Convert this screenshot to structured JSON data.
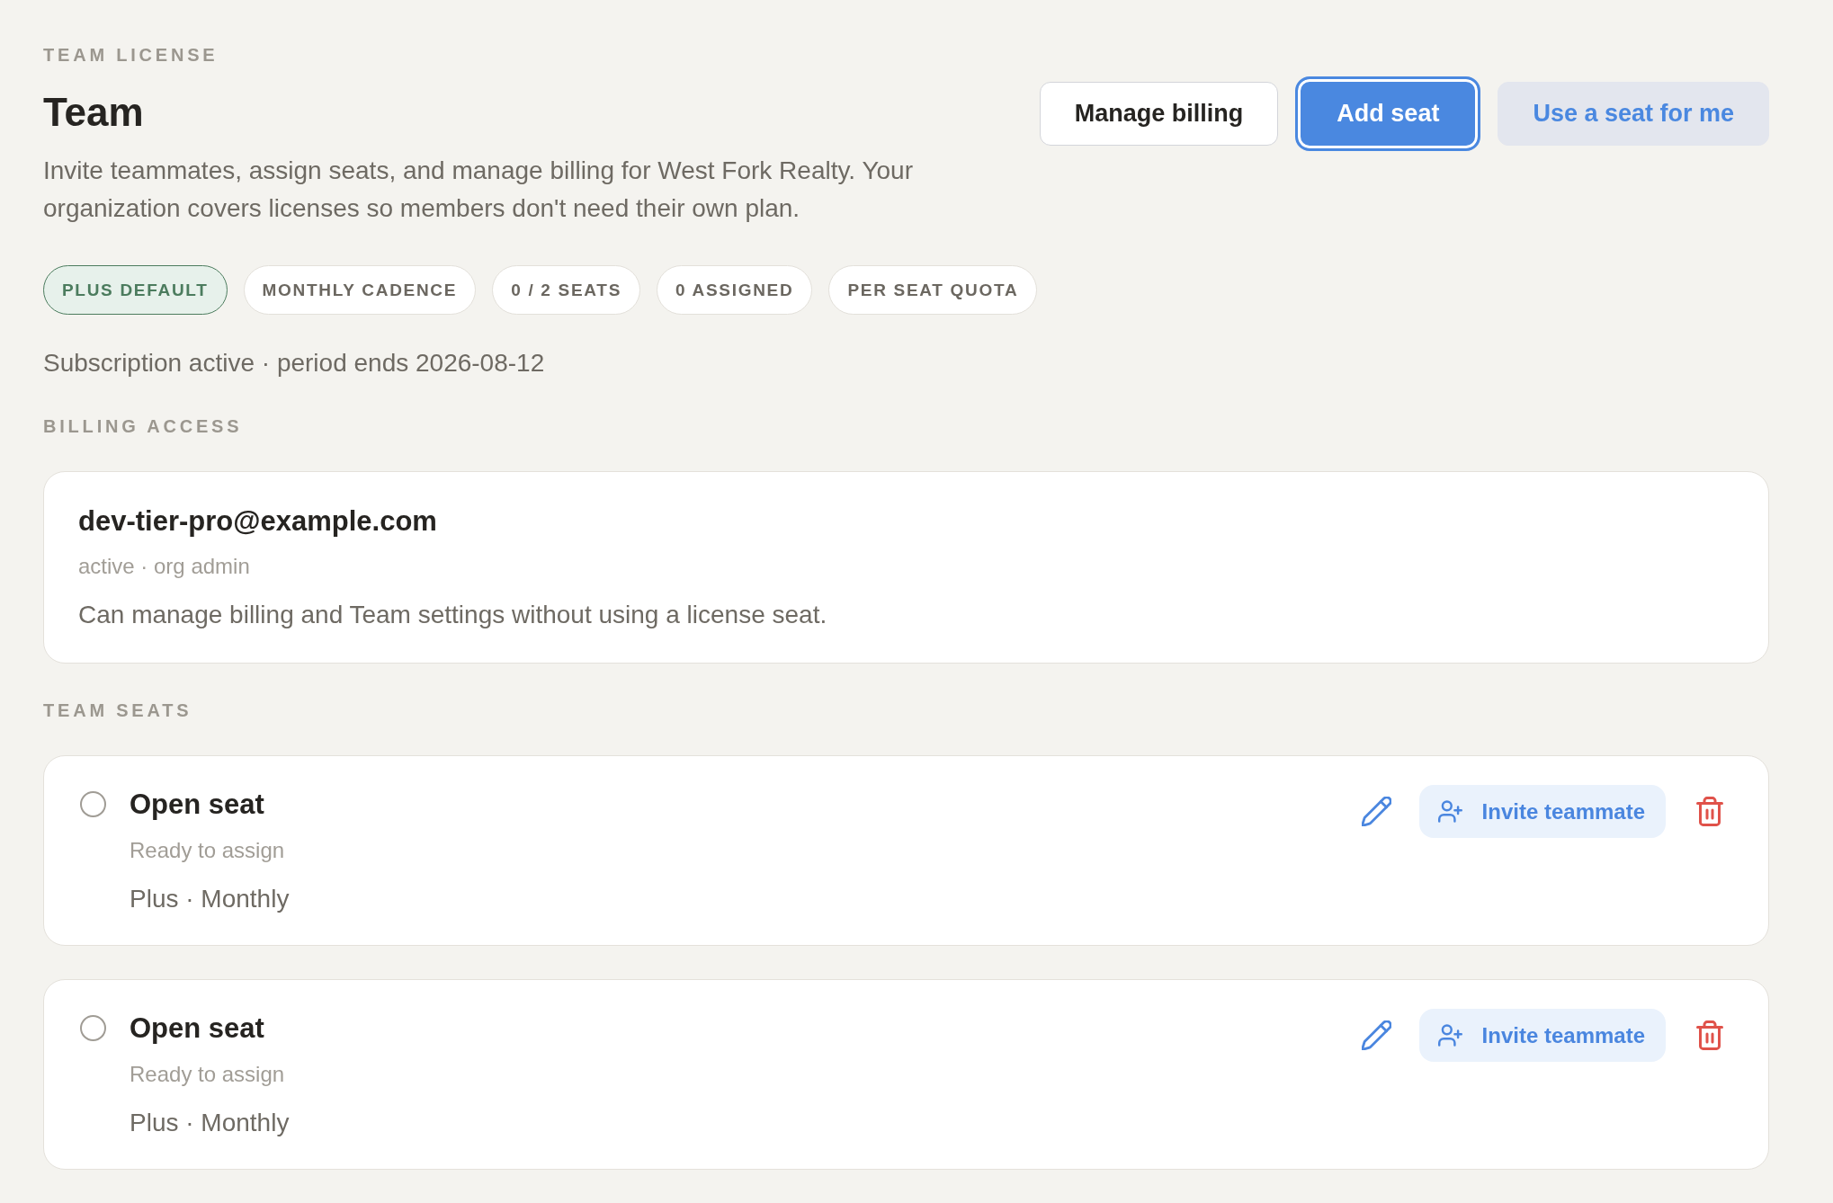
{
  "header": {
    "eyebrow": "TEAM LICENSE",
    "title": "Team",
    "description": "Invite teammates, assign seats, and manage billing for West Fork Realty. Your organization covers licenses so members don't need their own plan.",
    "buttons": [
      {
        "label": "Manage billing",
        "kind": "outline",
        "focused": false
      },
      {
        "label": "Add seat",
        "kind": "primary",
        "focused": true
      },
      {
        "label": "Use a seat for me",
        "kind": "soft",
        "focused": false
      }
    ]
  },
  "chips": [
    {
      "label": "PLUS DEFAULT",
      "kind": "accent"
    },
    {
      "label": "MONTHLY CADENCE",
      "kind": "plain"
    },
    {
      "label": "0 / 2 SEATS",
      "kind": "plain"
    },
    {
      "label": "0 ASSIGNED",
      "kind": "plain"
    },
    {
      "label": "PER SEAT QUOTA",
      "kind": "plain"
    }
  ],
  "subscription_status": "Subscription active · period ends 2026-08-12",
  "billing_access": {
    "heading": "BILLING ACCESS",
    "email": "dev-tier-pro@example.com",
    "meta": "active · org admin",
    "note": "Can manage billing and Team settings without using a license seat."
  },
  "team_seats": {
    "heading": "TEAM SEATS",
    "seats": [
      {
        "title": "Open seat",
        "status": "Ready to assign",
        "plan": "Plus · Monthly",
        "selected": false,
        "invite_label": "Invite teammate"
      },
      {
        "title": "Open seat",
        "status": "Ready to assign",
        "plan": "Plus · Monthly",
        "selected": false,
        "invite_label": "Invite teammate"
      }
    ]
  }
}
